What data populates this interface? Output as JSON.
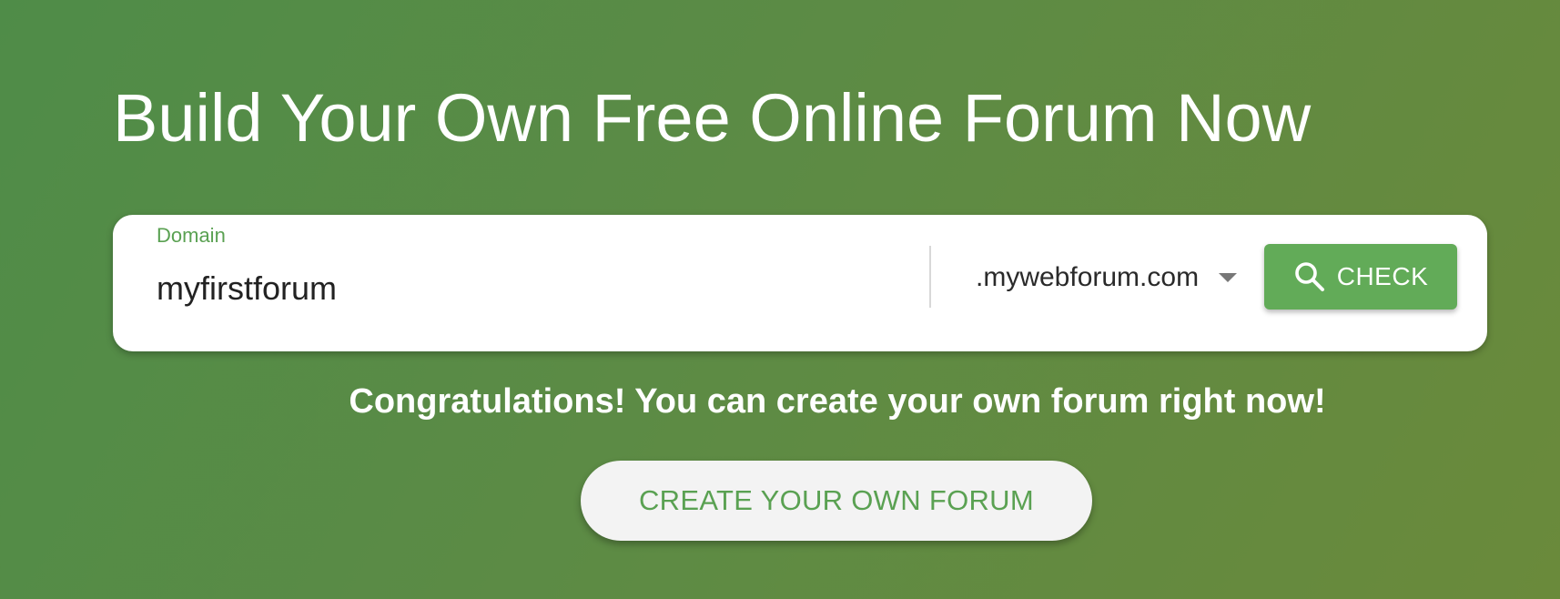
{
  "hero": {
    "title": "Build Your Own Free Online Forum Now"
  },
  "domain_form": {
    "label": "Domain",
    "value": "myfirstforum",
    "tld_selected": ".mywebforum.com",
    "check_label": "CHECK"
  },
  "result": {
    "message": "Congratulations! You can create your own forum right now!",
    "create_label": "CREATE YOUR OWN FORUM"
  },
  "icons": {
    "search": "search-icon",
    "dropdown": "caret-down-icon"
  },
  "colors": {
    "accent": "#62ab58",
    "label": "#5aa152",
    "background_start": "#4f8c48",
    "background_end": "#6a8a3b"
  }
}
